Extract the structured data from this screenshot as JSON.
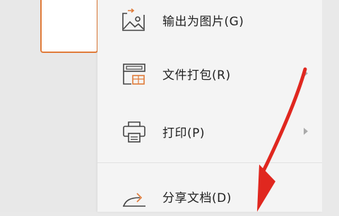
{
  "colors": {
    "accent": "#e07b39",
    "menu_bg": "#f4f4f4",
    "annotation_arrow": "#e0271f"
  },
  "menu": {
    "items": [
      {
        "label": "输出为图片(G)",
        "icon": "image-export-icon",
        "has_submenu": false
      },
      {
        "label": "文件打包(R)",
        "icon": "file-package-icon",
        "has_submenu": true
      },
      {
        "label": "打印(P)",
        "icon": "printer-icon",
        "has_submenu": true
      },
      {
        "label": "分享文档(D)",
        "icon": "share-icon",
        "has_submenu": false
      }
    ]
  }
}
